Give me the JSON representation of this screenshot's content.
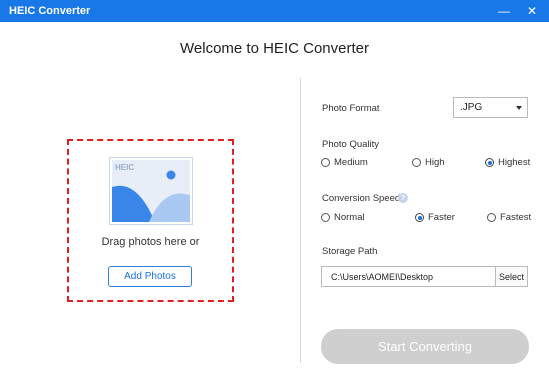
{
  "window": {
    "title": "HEIC Converter",
    "minimize_icon": "minimize-icon",
    "close_icon": "close-icon"
  },
  "welcome": "Welcome to HEIC Converter",
  "drop_zone": {
    "illustration_badge": "HEIC",
    "hint": "Drag photos here or",
    "add_button": "Add Photos",
    "border_color": "#e02020"
  },
  "settings": {
    "format": {
      "label": "Photo Format",
      "selected": ".JPG"
    },
    "quality": {
      "label": "Photo Quality",
      "options": [
        "Medium",
        "High",
        "Highest"
      ],
      "selected": "Highest"
    },
    "speed": {
      "label": "Conversion Speed",
      "help_icon": "help-icon",
      "options": [
        "Normal",
        "Faster",
        "Fastest"
      ],
      "selected": "Faster"
    },
    "storage": {
      "label": "Storage Path",
      "path": "C:\\Users\\AOMEI\\Desktop",
      "select_button": "Select"
    }
  },
  "start_button": "Start Converting",
  "colors": {
    "accent": "#1878e8",
    "start_disabled": "#cfcfcf"
  }
}
